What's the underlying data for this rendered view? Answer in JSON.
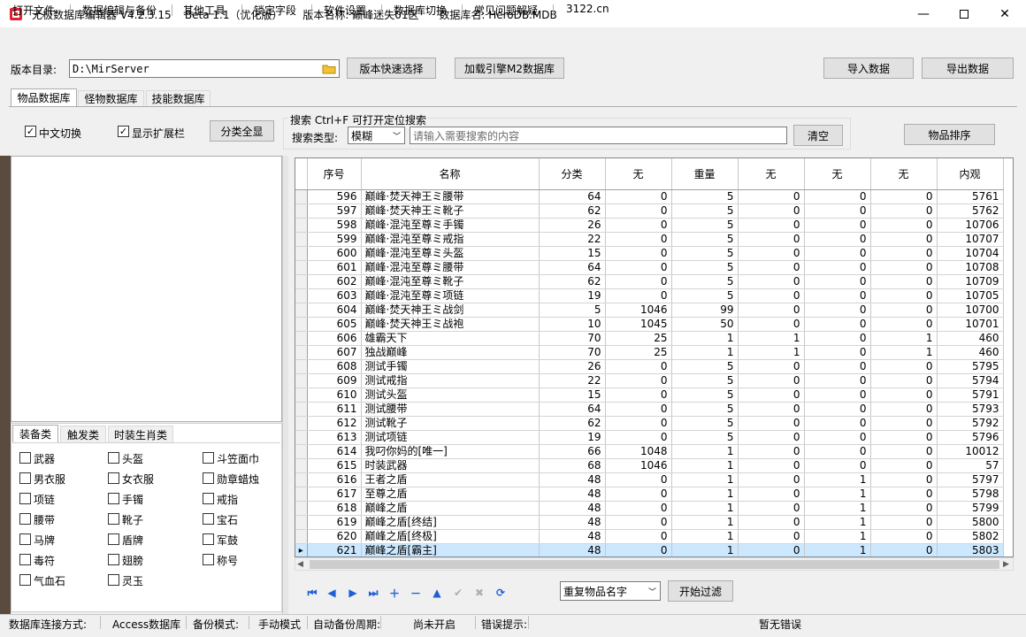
{
  "window": {
    "title": "无极数据库编辑器 V4.2.3.15    Beta 1.1（优化版）      版本名称: 巅峰迷失01区      数据库名: HeroDB.MDB"
  },
  "menu": [
    "打开文件",
    "数据编辑与备份",
    "其他工具",
    "锁定字段",
    "软件设置",
    "数据库切换",
    "常见问题解疑",
    "3122.cn"
  ],
  "toolbar": {
    "dir_label": "版本目录:",
    "dir_value": "D:\\MirServer",
    "quick_select": "版本快速选择",
    "load_m2": "加载引擎M2数据库",
    "import": "导入数据",
    "export": "导出数据"
  },
  "tabs": [
    "物品数据库",
    "怪物数据库",
    "技能数据库"
  ],
  "options": {
    "chinese_toggle": "中文切换",
    "show_ext": "显示扩展栏",
    "show_all": "分类全显",
    "search_title": "搜索   Ctrl+F 可打开定位搜索",
    "search_type_label": "搜索类型:",
    "search_type_value": "模糊",
    "search_placeholder": "请输入需要搜索的内容",
    "clear": "清空",
    "sort": "物品排序"
  },
  "category_tabs": [
    "装备类",
    "触发类",
    "时装生肖类"
  ],
  "categories": [
    "武器",
    "头盔",
    "斗笠面巾",
    "男衣服",
    "女衣服",
    "勋章蜡烛",
    "项链",
    "手镯",
    "戒指",
    "腰带",
    "靴子",
    "宝石",
    "马牌",
    "盾牌",
    "军鼓",
    "毒符",
    "翅膀",
    "称号",
    "气血石",
    "灵玉"
  ],
  "table": {
    "headers": [
      "序号",
      "名称",
      "分类",
      "无",
      "重量",
      "无",
      "无",
      "无",
      "内观"
    ],
    "rows": [
      [
        "596",
        "巅峰·焚天神王ミ腰带",
        "64",
        "0",
        "5",
        "0",
        "0",
        "0",
        "5761"
      ],
      [
        "597",
        "巅峰·焚天神王ミ靴子",
        "62",
        "0",
        "5",
        "0",
        "0",
        "0",
        "5762"
      ],
      [
        "598",
        "巅峰·混沌至尊ミ手镯",
        "26",
        "0",
        "5",
        "0",
        "0",
        "0",
        "10706"
      ],
      [
        "599",
        "巅峰·混沌至尊ミ戒指",
        "22",
        "0",
        "5",
        "0",
        "0",
        "0",
        "10707"
      ],
      [
        "600",
        "巅峰·混沌至尊ミ头盔",
        "15",
        "0",
        "5",
        "0",
        "0",
        "0",
        "10704"
      ],
      [
        "601",
        "巅峰·混沌至尊ミ腰带",
        "64",
        "0",
        "5",
        "0",
        "0",
        "0",
        "10708"
      ],
      [
        "602",
        "巅峰·混沌至尊ミ靴子",
        "62",
        "0",
        "5",
        "0",
        "0",
        "0",
        "10709"
      ],
      [
        "603",
        "巅峰·混沌至尊ミ项链",
        "19",
        "0",
        "5",
        "0",
        "0",
        "0",
        "10705"
      ],
      [
        "604",
        "巅峰·焚天神王ミ战剑",
        "5",
        "1046",
        "99",
        "0",
        "0",
        "0",
        "10700"
      ],
      [
        "605",
        "巅峰·焚天神王ミ战袍",
        "10",
        "1045",
        "50",
        "0",
        "0",
        "0",
        "10701"
      ],
      [
        "606",
        "雄霸天下",
        "70",
        "25",
        "1",
        "1",
        "0",
        "1",
        "460"
      ],
      [
        "607",
        "独战巅峰",
        "70",
        "25",
        "1",
        "1",
        "0",
        "1",
        "460"
      ],
      [
        "608",
        "测试手镯",
        "26",
        "0",
        "5",
        "0",
        "0",
        "0",
        "5795"
      ],
      [
        "609",
        "测试戒指",
        "22",
        "0",
        "5",
        "0",
        "0",
        "0",
        "5794"
      ],
      [
        "610",
        "测试头盔",
        "15",
        "0",
        "5",
        "0",
        "0",
        "0",
        "5791"
      ],
      [
        "611",
        "测试腰带",
        "64",
        "0",
        "5",
        "0",
        "0",
        "0",
        "5793"
      ],
      [
        "612",
        "测试靴子",
        "62",
        "0",
        "5",
        "0",
        "0",
        "0",
        "5792"
      ],
      [
        "613",
        "测试项链",
        "19",
        "0",
        "5",
        "0",
        "0",
        "0",
        "5796"
      ],
      [
        "614",
        "我叼你妈的[唯一]",
        "66",
        "1048",
        "1",
        "0",
        "0",
        "0",
        "10012"
      ],
      [
        "615",
        "时装武器",
        "68",
        "1046",
        "1",
        "0",
        "0",
        "0",
        "57"
      ],
      [
        "616",
        "王者之盾",
        "48",
        "0",
        "1",
        "0",
        "1",
        "0",
        "5797"
      ],
      [
        "617",
        "至尊之盾",
        "48",
        "0",
        "1",
        "0",
        "1",
        "0",
        "5798"
      ],
      [
        "618",
        "巅峰之盾",
        "48",
        "0",
        "1",
        "0",
        "1",
        "0",
        "5799"
      ],
      [
        "619",
        "巅峰之盾[终结]",
        "48",
        "0",
        "1",
        "0",
        "1",
        "0",
        "5800"
      ],
      [
        "620",
        "巅峰之盾[终极]",
        "48",
        "0",
        "1",
        "0",
        "1",
        "0",
        "5802"
      ],
      [
        "621",
        "巅峰之盾[霸主]",
        "48",
        "0",
        "1",
        "0",
        "1",
        "0",
        "5803"
      ]
    ]
  },
  "filter": {
    "dup_value": "重复物品名字",
    "start": "开始过滤"
  },
  "status": [
    "数据库连接方式:",
    "Access数据库",
    "备份模式:",
    "手动模式",
    "自动备份周期:",
    "尚未开启",
    "错误提示:",
    "暂无错误"
  ],
  "colors": {
    "selection": "#cce8ff",
    "nav_blue": "#1e5fd6"
  }
}
